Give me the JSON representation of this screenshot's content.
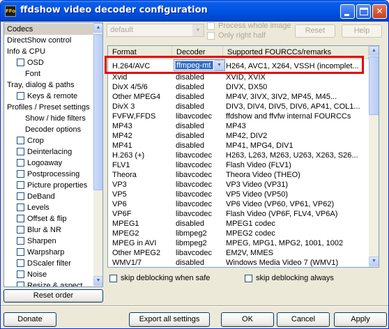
{
  "window": {
    "title": "ffdshow video decoder configuration",
    "app_icon": "FFo"
  },
  "tree": {
    "items": [
      {
        "label": "Codecs",
        "indent": 0,
        "checkbox": false,
        "selected": true
      },
      {
        "label": "DirectShow control",
        "indent": 0,
        "checkbox": false
      },
      {
        "label": "Info & CPU",
        "indent": 0,
        "checkbox": false
      },
      {
        "label": "OSD",
        "indent": 1,
        "checkbox": true
      },
      {
        "label": "Font",
        "indent": 2,
        "checkbox": false
      },
      {
        "label": "Tray, dialog & paths",
        "indent": 0,
        "checkbox": false
      },
      {
        "label": "Keys & remote",
        "indent": 1,
        "checkbox": true
      },
      {
        "label": "Profiles / Preset settings",
        "indent": 0,
        "checkbox": false
      },
      {
        "label": "Show / hide filters",
        "indent": 2,
        "checkbox": false
      },
      {
        "label": "Decoder options",
        "indent": 2,
        "checkbox": false
      },
      {
        "label": "Crop",
        "indent": 1,
        "checkbox": true
      },
      {
        "label": "Deinterlacing",
        "indent": 1,
        "checkbox": true
      },
      {
        "label": "Logoaway",
        "indent": 1,
        "checkbox": true
      },
      {
        "label": "Postprocessing",
        "indent": 1,
        "checkbox": true
      },
      {
        "label": "Picture properties",
        "indent": 1,
        "checkbox": true
      },
      {
        "label": "DeBand",
        "indent": 1,
        "checkbox": true
      },
      {
        "label": "Levels",
        "indent": 1,
        "checkbox": true
      },
      {
        "label": "Offset & flip",
        "indent": 1,
        "checkbox": true
      },
      {
        "label": "Blur & NR",
        "indent": 1,
        "checkbox": true
      },
      {
        "label": "Sharpen",
        "indent": 1,
        "checkbox": true
      },
      {
        "label": "Warpsharp",
        "indent": 1,
        "checkbox": true
      },
      {
        "label": "DScaler filter",
        "indent": 1,
        "checkbox": true
      },
      {
        "label": "Noise",
        "indent": 1,
        "checkbox": true
      },
      {
        "label": "Resize & aspect",
        "indent": 1,
        "checkbox": true
      }
    ]
  },
  "top": {
    "profile_value": "default",
    "process_whole_image": "Process whole image",
    "only_right_half": "Only right half",
    "reset_label": "Reset",
    "help_label": "Help"
  },
  "list": {
    "headers": [
      "Format",
      "Decoder",
      "Supported FOURCCs/remarks"
    ],
    "rows": [
      [
        "H.264/AVC",
        "ffmpeg-mt",
        "H264, AVC1, X264, VSSH (incomplet..."
      ],
      [
        "Xvid",
        "disabled",
        "XVID, XVIX"
      ],
      [
        "DivX 4/5/6",
        "disabled",
        "DIVX, DX50"
      ],
      [
        "Other MPEG4",
        "disabled",
        "MP4V, 3IVX, 3IV2, MP45, M45..."
      ],
      [
        "DivX 3",
        "disabled",
        "DIV3, DIV4, DIV5, DIV6, AP41, COL1..."
      ],
      [
        "FVFW,FFDS",
        "libavcodec",
        "ffdshow and ffvfw internal FOURCCs"
      ],
      [
        "MP43",
        "disabled",
        "MP43"
      ],
      [
        "MP42",
        "disabled",
        "MP42, DIV2"
      ],
      [
        "MP41",
        "disabled",
        "MP41, MPG4, DIV1"
      ],
      [
        "H.263 (+)",
        "libavcodec",
        "H263, L263, M263, U263, X263, S26..."
      ],
      [
        "FLV1",
        "libavcodec",
        "Flash Video (FLV1)"
      ],
      [
        "Theora",
        "libavcodec",
        "Theora Video (THEO)"
      ],
      [
        "VP3",
        "libavcodec",
        "VP3 Video (VP31)"
      ],
      [
        "VP5",
        "libavcodec",
        "VP5 Video (VP50)"
      ],
      [
        "VP6",
        "libavcodec",
        "VP6 Video (VP60, VP61, VP62)"
      ],
      [
        "VP6F",
        "libavcodec",
        "Flash Video (VP6F, FLV4, VP6A)"
      ],
      [
        "MPEG1",
        "disabled",
        "MPEG1 codec"
      ],
      [
        "MPEG2",
        "libmpeg2",
        "MPEG2 codec"
      ],
      [
        "MPEG in AVI",
        "libmpeg2",
        "MPEG, MPG1, MPG2, 1001, 1002"
      ],
      [
        "Other MPEG2",
        "libavcodec",
        "EM2V, MMES"
      ],
      [
        "WMV1/7",
        "disabled",
        "Windows Media Video 7 (WMV1)"
      ]
    ]
  },
  "options": {
    "skip_deblocking_safe": "skip deblocking when safe",
    "skip_deblocking_always": "skip deblocking always"
  },
  "buttons": {
    "reset_order": "Reset order",
    "donate": "Donate",
    "export_all": "Export all settings",
    "ok": "OK",
    "cancel": "Cancel",
    "apply": "Apply"
  },
  "colors": {
    "highlight_box": "#e50000",
    "selection": "#316ac5",
    "titlebar": "#0055e5"
  }
}
